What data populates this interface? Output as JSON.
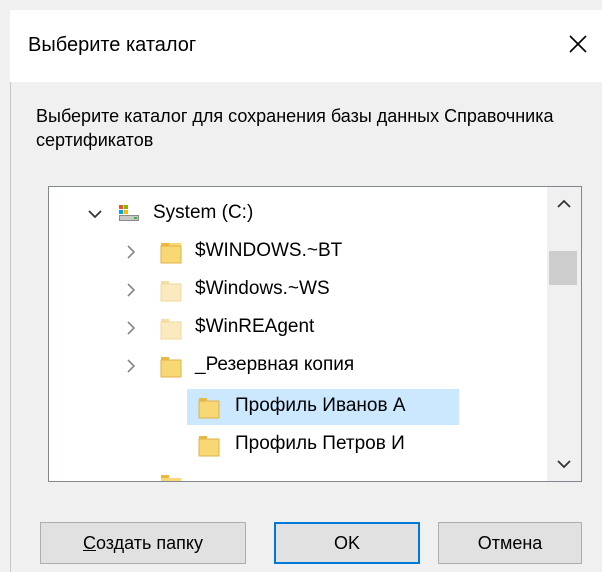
{
  "window": {
    "title": "Выберите каталог",
    "close_icon": "close-icon"
  },
  "description": {
    "text": "Выберите каталог для сохранения базы данных Справочника сертификатов"
  },
  "tree": {
    "items": [
      {
        "label": "System (C:)",
        "level": 0,
        "expanded": true,
        "icon": "drive-icon",
        "has_children": true,
        "selected": false
      },
      {
        "label": "$WINDOWS.~BT",
        "level": 1,
        "expanded": false,
        "icon": "folder-icon",
        "has_children": true,
        "selected": false
      },
      {
        "label": "$Windows.~WS",
        "level": 1,
        "expanded": false,
        "icon": "folder-hidden-icon",
        "has_children": true,
        "selected": false
      },
      {
        "label": "$WinREAgent",
        "level": 1,
        "expanded": false,
        "icon": "folder-hidden-icon",
        "has_children": true,
        "selected": false
      },
      {
        "label": "_Резервная копия",
        "level": 1,
        "expanded": true,
        "icon": "folder-icon",
        "has_children": true,
        "selected": false
      },
      {
        "label": "Профиль Иванов А",
        "level": 2,
        "expanded": false,
        "icon": "folder-icon",
        "has_children": false,
        "selected": true
      },
      {
        "label": "Профиль Петров И",
        "level": 2,
        "expanded": false,
        "icon": "folder-icon",
        "has_children": false,
        "selected": false
      }
    ]
  },
  "buttons": {
    "create_folder_accel": "С",
    "create_folder_rest": "оздать папку",
    "ok": "OK",
    "cancel": "Отмена"
  },
  "colors": {
    "selection": "#cce8ff",
    "accent": "#0078d7",
    "folder": "#f8d775",
    "folder_hidden": "#fbe9bf"
  }
}
